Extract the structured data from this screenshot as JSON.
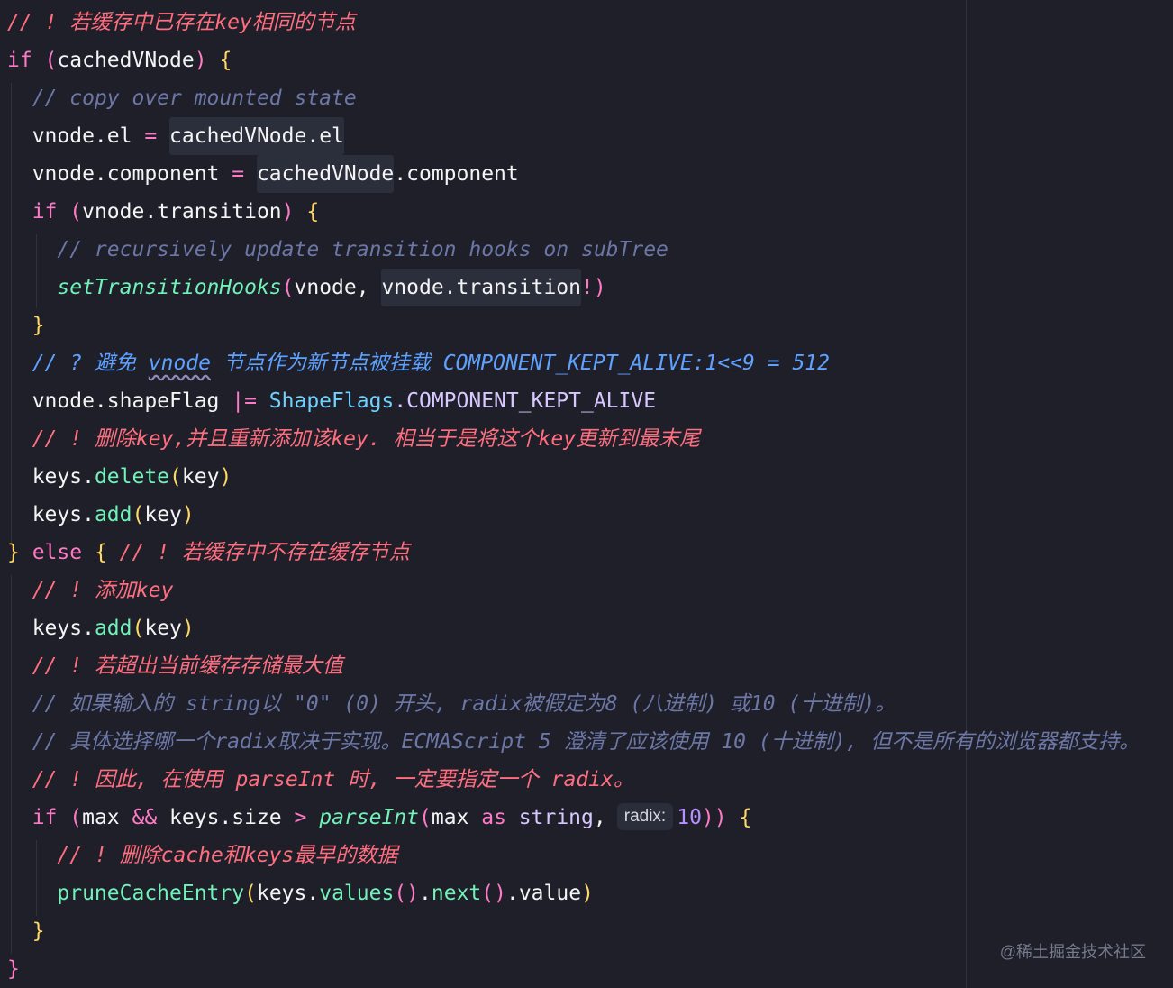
{
  "editor": {
    "lines": [
      {
        "tokens": [
          {
            "text": "// ! 若缓存中已存在key相同的节点",
            "kind": "comment-red"
          }
        ]
      },
      {
        "tokens": [
          {
            "text": "if",
            "kind": "keyword"
          },
          {
            "text": " (",
            "kind": "bracket-pink"
          },
          {
            "text": "cachedVNode",
            "kind": "ident"
          },
          {
            "text": ")",
            "kind": "bracket-pink"
          },
          {
            "text": " {",
            "kind": "bracket-yellow"
          }
        ]
      },
      {
        "tokens": [
          {
            "text": "  // copy over mounted state",
            "kind": "comment"
          }
        ]
      },
      {
        "tokens": [
          {
            "text": "  vnode.el ",
            "kind": "ident"
          },
          {
            "text": "= ",
            "kind": "operator"
          },
          {
            "text": "cachedVNode.el",
            "kind": "ident",
            "highlight": true
          }
        ]
      },
      {
        "tokens": [
          {
            "text": "  vnode.component ",
            "kind": "ident"
          },
          {
            "text": "= ",
            "kind": "operator"
          },
          {
            "text": "cachedVNode",
            "kind": "ident",
            "highlight": true
          },
          {
            "text": ".component",
            "kind": "ident"
          }
        ]
      },
      {
        "tokens": [
          {
            "text": "  if",
            "kind": "keyword"
          },
          {
            "text": " (",
            "kind": "bracket-pink"
          },
          {
            "text": "vnode.transition",
            "kind": "ident"
          },
          {
            "text": ")",
            "kind": "bracket-pink"
          },
          {
            "text": " {",
            "kind": "bracket-yellow"
          }
        ]
      },
      {
        "tokens": [
          {
            "text": "    // recursively update transition hooks on subTree",
            "kind": "comment"
          }
        ]
      },
      {
        "tokens": [
          {
            "text": "    setTransitionHooks",
            "kind": "fn-italic"
          },
          {
            "text": "(",
            "kind": "bracket-pink"
          },
          {
            "text": "vnode, ",
            "kind": "ident"
          },
          {
            "text": "vnode.transition",
            "kind": "ident",
            "highlight": true
          },
          {
            "text": "!",
            "kind": "operator"
          },
          {
            "text": ")",
            "kind": "bracket-pink"
          }
        ]
      },
      {
        "tokens": [
          {
            "text": "  }",
            "kind": "bracket-yellow"
          }
        ]
      },
      {
        "tokens": [
          {
            "text": "  // ? 避免 ",
            "kind": "comment-blue"
          },
          {
            "text": "vnode",
            "kind": "comment-blue",
            "squiggle": true
          },
          {
            "text": " 节点作为新节点被挂载 COMPONENT_KEPT_ALIVE:1<<9 = 512",
            "kind": "comment-blue"
          }
        ]
      },
      {
        "tokens": [
          {
            "text": "  vnode.shapeFlag ",
            "kind": "ident"
          },
          {
            "text": "|= ",
            "kind": "operator"
          },
          {
            "text": "ShapeFlags",
            "kind": "type"
          },
          {
            "text": ".COMPONENT_KEPT_ALIVE",
            "kind": "string-like"
          }
        ]
      },
      {
        "tokens": [
          {
            "text": "  // ! 删除key,并且重新添加该key. 相当于是将这个key更新到最末尾",
            "kind": "comment-red"
          }
        ]
      },
      {
        "tokens": [
          {
            "text": "  keys.",
            "kind": "ident"
          },
          {
            "text": "delete",
            "kind": "fn"
          },
          {
            "text": "(",
            "kind": "bracket-yellow"
          },
          {
            "text": "key",
            "kind": "ident"
          },
          {
            "text": ")",
            "kind": "bracket-yellow"
          }
        ]
      },
      {
        "tokens": [
          {
            "text": "  keys.",
            "kind": "ident"
          },
          {
            "text": "add",
            "kind": "fn"
          },
          {
            "text": "(",
            "kind": "bracket-yellow"
          },
          {
            "text": "key",
            "kind": "ident"
          },
          {
            "text": ")",
            "kind": "bracket-yellow"
          }
        ]
      },
      {
        "tokens": [
          {
            "text": "} ",
            "kind": "bracket-yellow"
          },
          {
            "text": "else",
            "kind": "keyword"
          },
          {
            "text": " { ",
            "kind": "bracket-yellow"
          },
          {
            "text": "// ! 若缓存中不存在缓存节点",
            "kind": "comment-red"
          }
        ]
      },
      {
        "tokens": [
          {
            "text": "  // ! 添加key",
            "kind": "comment-red"
          }
        ]
      },
      {
        "tokens": [
          {
            "text": "  keys.",
            "kind": "ident"
          },
          {
            "text": "add",
            "kind": "fn"
          },
          {
            "text": "(",
            "kind": "bracket-yellow"
          },
          {
            "text": "key",
            "kind": "ident"
          },
          {
            "text": ")",
            "kind": "bracket-yellow"
          }
        ]
      },
      {
        "tokens": [
          {
            "text": "  // ! 若超出当前缓存存储最大值",
            "kind": "comment-red"
          }
        ]
      },
      {
        "tokens": [
          {
            "text": "  // 如果输入的 string以 \"0\" (0) 开头, radix被假定为8 (八进制) 或10 (十进制)。",
            "kind": "comment"
          }
        ]
      },
      {
        "tokens": [
          {
            "text": "  // 具体选择哪一个radix取决于实现。ECMAScript 5 澄清了应该使用 10 (十进制), 但不是所有的浏览器都支持。",
            "kind": "comment"
          }
        ]
      },
      {
        "tokens": [
          {
            "text": "  // ! 因此, 在使用 parseInt 时, 一定要指定一个 radix。",
            "kind": "comment-red"
          }
        ]
      },
      {
        "tokens": [
          {
            "text": "  if",
            "kind": "keyword"
          },
          {
            "text": " (",
            "kind": "bracket-pink"
          },
          {
            "text": "max ",
            "kind": "ident"
          },
          {
            "text": "&& ",
            "kind": "operator"
          },
          {
            "text": "keys.size ",
            "kind": "ident"
          },
          {
            "text": "> ",
            "kind": "operator"
          },
          {
            "text": "parseInt",
            "kind": "fn-italic"
          },
          {
            "text": "(",
            "kind": "bracket-pink"
          },
          {
            "text": "max ",
            "kind": "ident"
          },
          {
            "text": "as ",
            "kind": "keyword"
          },
          {
            "text": "string",
            "kind": "string-like"
          },
          {
            "text": ",",
            "kind": "punc"
          },
          {
            "hint": "radix:"
          },
          {
            "text": "10",
            "kind": "number"
          },
          {
            "text": "))",
            "kind": "bracket-pink"
          },
          {
            "text": " {",
            "kind": "bracket-yellow"
          }
        ]
      },
      {
        "tokens": [
          {
            "text": "    // ! 删除cache和keys最早的数据",
            "kind": "comment-red"
          }
        ]
      },
      {
        "tokens": [
          {
            "text": "    pruneCacheEntry",
            "kind": "fn"
          },
          {
            "text": "(",
            "kind": "bracket-yellow"
          },
          {
            "text": "keys.",
            "kind": "ident"
          },
          {
            "text": "values",
            "kind": "fn"
          },
          {
            "text": "()",
            "kind": "bracket-pink"
          },
          {
            "text": ".",
            "kind": "punc"
          },
          {
            "text": "next",
            "kind": "fn"
          },
          {
            "text": "()",
            "kind": "bracket-pink"
          },
          {
            "text": ".value",
            "kind": "ident"
          },
          {
            "text": ")",
            "kind": "bracket-yellow"
          }
        ]
      },
      {
        "tokens": [
          {
            "text": "  }",
            "kind": "bracket-yellow"
          }
        ]
      },
      {
        "tokens": [
          {
            "text": "}",
            "kind": "bracket-pink"
          }
        ]
      }
    ]
  },
  "watermark": "@稀土掘金技术社区"
}
